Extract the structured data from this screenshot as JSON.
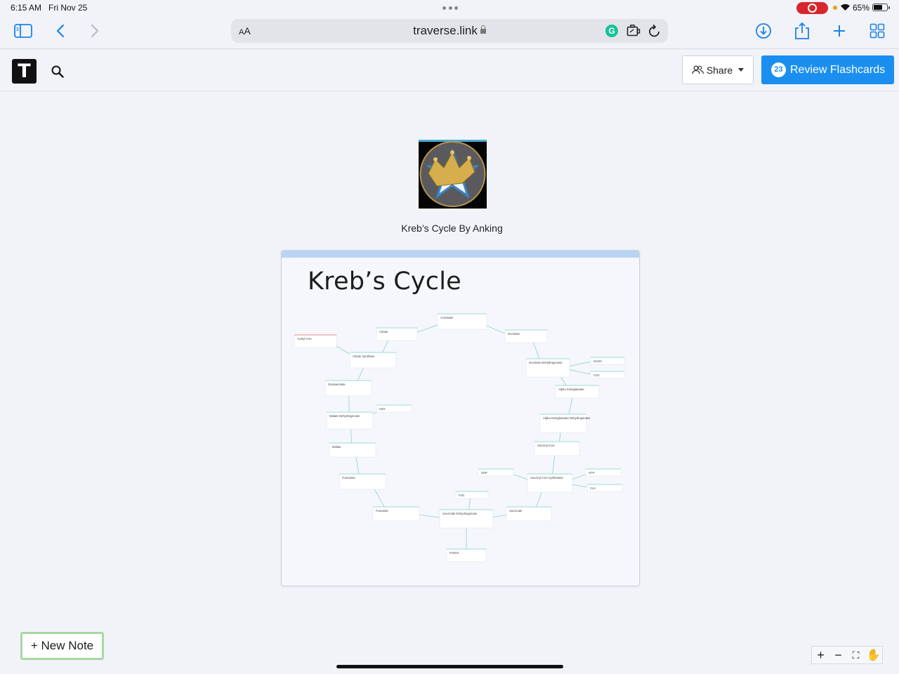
{
  "status_bar": {
    "time": "6:15 AM",
    "date": "Fri Nov 25",
    "battery_pct": "65%",
    "battery_level": 0.65
  },
  "browser": {
    "text_size_label": "AA",
    "url": "traverse.link",
    "icons": [
      "sidebar-icon",
      "back-icon",
      "forward-icon",
      "grammarly-icon",
      "extension-icon",
      "reload-icon",
      "download-icon",
      "share-icon",
      "new-tab-icon",
      "tabs-overview-icon"
    ],
    "grammarly_letter": "G"
  },
  "app": {
    "logo_letter": "T",
    "share_label": "Share",
    "flashcard_count": "23",
    "review_label": "Review Flashcards"
  },
  "project": {
    "title": "Kreb’s Cycle By Anking"
  },
  "canvas": {
    "heading": "Kreb’s Cycle",
    "nodes": [
      "Aconitase",
      "Citrate",
      "Isocitrate",
      "Acetyl CoA",
      "Citrate Synthase",
      "Isocitrate Dehydrogenase",
      "Oxaloacetate",
      "Alpha Ketoglutarate",
      "Malate Dehydrogenase",
      "Alpha Ketoglutarate Dehydrogenase",
      "Succinyl CoA",
      "Malate",
      "Fumarase",
      "Succinyl CoA Synthetase",
      "Fumarate",
      "Succinate",
      "Succinate Dehydrogenase",
      "FADH2",
      "NADH",
      "CO2",
      "GTP",
      "GDP",
      "CoA",
      "H2O",
      "FAD"
    ]
  },
  "new_note_label": "+ New Note",
  "zoom_controls": [
    "+",
    "−",
    "⛶",
    "✋"
  ]
}
